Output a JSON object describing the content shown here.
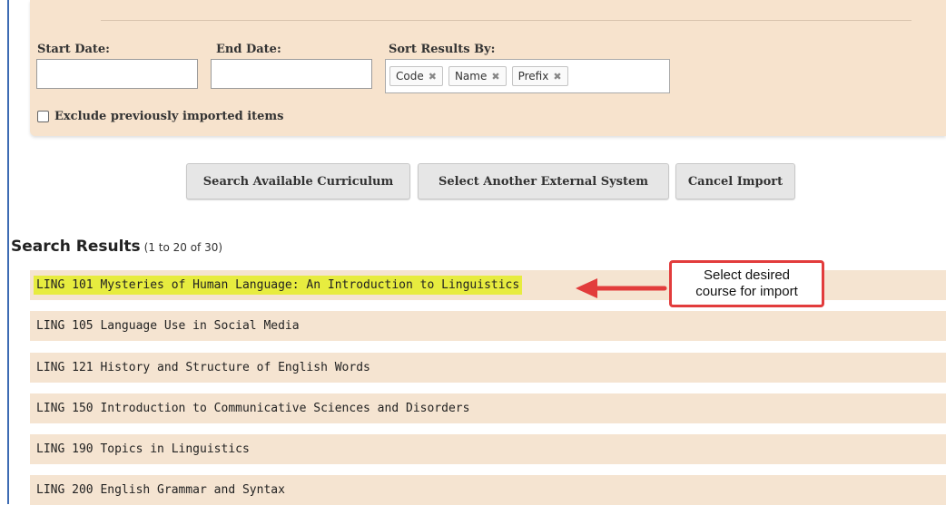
{
  "search_panel": {
    "start_date_label": "Start Date:",
    "start_date_value": "",
    "end_date_label": "End Date:",
    "end_date_value": "",
    "sort_label": "Sort Results By:",
    "sort_chips": [
      "Code",
      "Name",
      "Prefix"
    ],
    "exclude_label": "Exclude previously imported items",
    "exclude_checked": false
  },
  "buttons": {
    "search": "Search Available Curriculum",
    "select_other": "Select Another External System",
    "cancel": "Cancel Import"
  },
  "results": {
    "title": "Search Results",
    "count": "(1 to 20 of 30)",
    "items": [
      "LING 101 Mysteries of Human Language: An Introduction to Linguistics",
      "LING 105 Language Use in Social Media",
      "LING 121 History and Structure of English Words",
      "LING 150 Introduction to Communicative Sciences and Disorders",
      "LING 190 Topics in Linguistics",
      "LING 200 English Grammar and Syntax"
    ]
  },
  "callout": {
    "line1": "Select desired",
    "line2": "course for import",
    "border_color": "#e23c3c"
  },
  "colors": {
    "panel_bg": "#f7e3cd",
    "row_bg": "#f5e4d1",
    "highlight": "#e7ec3f"
  }
}
